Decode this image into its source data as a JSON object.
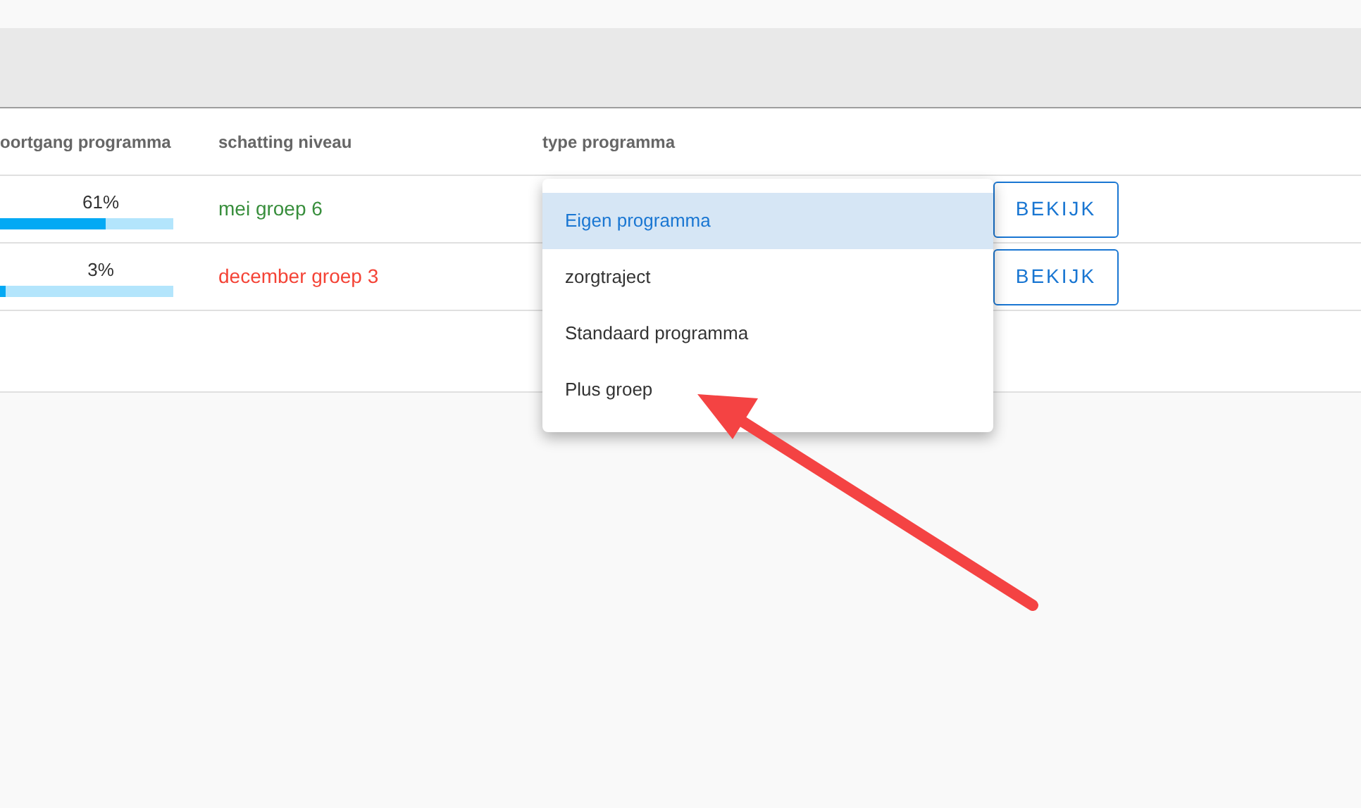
{
  "table": {
    "columns": [
      "oortgang programma",
      "schatting niveau",
      "type programma"
    ],
    "rows": [
      {
        "progress_label": "61%",
        "level": 0.61,
        "estimate": "mei groep 6",
        "color": "#388e3c",
        "action": "BEKIJK"
      },
      {
        "progress_label": "3%",
        "level": 0.03,
        "estimate": "december groep 3",
        "color": "#f44336",
        "action": "BEKIJK"
      }
    ]
  },
  "dropdown": {
    "options": [
      {
        "label": "Eigen programma",
        "selected": true
      },
      {
        "label": "zorgtraject",
        "selected": false
      },
      {
        "label": "Standaard programma",
        "selected": false
      },
      {
        "label": "Plus groep",
        "selected": false
      }
    ]
  },
  "annotation": {
    "kind": "arrow"
  }
}
